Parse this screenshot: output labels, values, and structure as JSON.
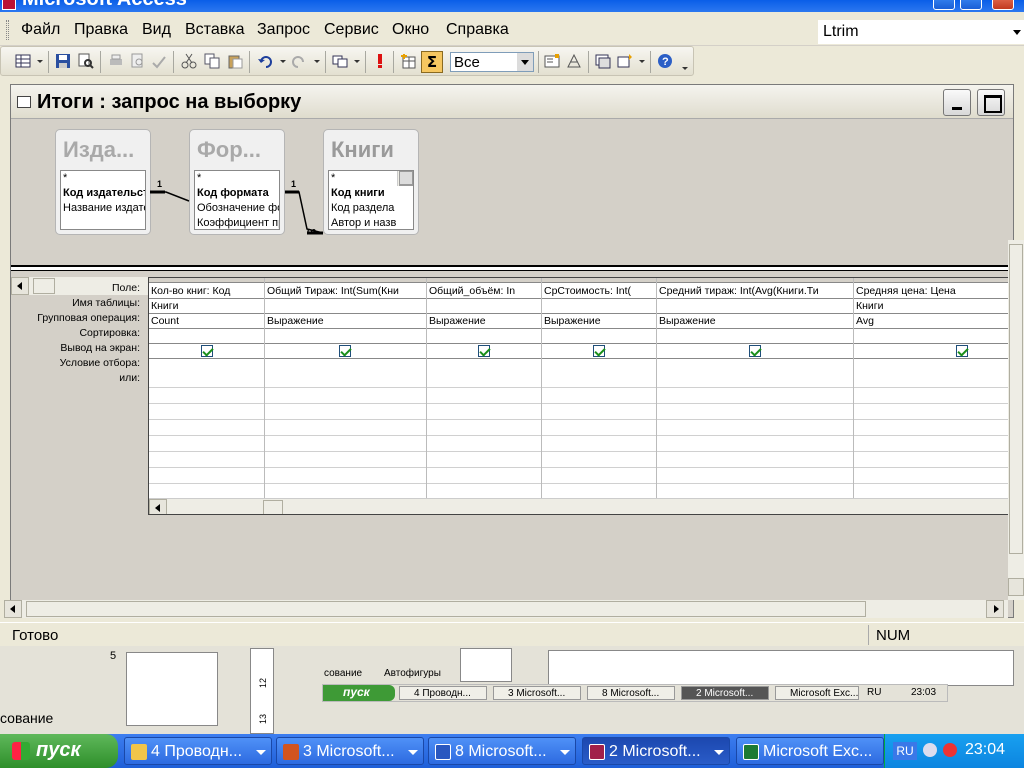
{
  "app": {
    "title": "Microsoft Access"
  },
  "menu": [
    "Файл",
    "Правка",
    "Вид",
    "Вставка",
    "Запрос",
    "Сервис",
    "Окно",
    "Справка"
  ],
  "help_box": {
    "value": "Ltrim"
  },
  "toolbar": {
    "sigma": "Σ",
    "top_values": "Все"
  },
  "query_window": {
    "title": "Итоги : запрос на выборку"
  },
  "tables": [
    {
      "title": "Изда...",
      "fields": [
        "*",
        "Код издательст",
        "Название издате"
      ],
      "pk_index": 1
    },
    {
      "title": "Фор...",
      "fields": [
        "*",
        "Код формата",
        "Обозначение фо",
        "Коэффициент пр"
      ],
      "pk_index": 1
    },
    {
      "title": "Книги",
      "fields": [
        "*",
        "Код книги",
        "Код раздела",
        "Автор и назв"
      ],
      "pk_index": 1
    }
  ],
  "relations": {
    "one_1": "1",
    "one_2": "1",
    "many": "∞"
  },
  "grid": {
    "row_labels": [
      "Поле:",
      "Имя таблицы:",
      "Групповая операция:",
      "Сортировка:",
      "Вывод на экран:",
      "Условие отбора:",
      "или:"
    ],
    "columns": [
      {
        "field": "Кол-во книг: Код",
        "table": "Книги",
        "group": "Count",
        "sort": "",
        "show": true
      },
      {
        "field": "Общий Тираж: Int(Sum(Кни",
        "table": "",
        "group": "Выражение",
        "sort": "",
        "show": true
      },
      {
        "field": "Общий_объём: In",
        "table": "",
        "group": "Выражение",
        "sort": "",
        "show": true
      },
      {
        "field": "СрСтоимость: Int(",
        "table": "",
        "group": "Выражение",
        "sort": "",
        "show": true
      },
      {
        "field": "Средний тираж: Int(Avg(Книги.Ти",
        "table": "",
        "group": "Выражение",
        "sort": "",
        "show": true
      },
      {
        "field": "Средняя цена: Цена",
        "table": "Книги",
        "group": "Avg",
        "sort": "",
        "show": true
      }
    ]
  },
  "status": {
    "text": "Готово",
    "num": "NUM"
  },
  "backdrop": {
    "page_number": "5",
    "ruler_12": "12",
    "ruler_13": "13",
    "drawing_label": "сование",
    "autoshapes": "Автофигуры",
    "left_drawing": "сование"
  },
  "mini_taskbar": {
    "start": "пуск",
    "tasks": [
      "4 Проводн...",
      "3 Microsoft...",
      "8 Microsoft...",
      "2 Microsoft...",
      "Microsoft Exc..."
    ],
    "lang": "RU",
    "clock": "23:03"
  },
  "taskbar": {
    "start": "пуск",
    "tasks": [
      "4 Проводн...",
      "3 Microsoft...",
      "8 Microsoft...",
      "2 Microsoft...",
      "Microsoft Exc..."
    ],
    "lang": "RU",
    "clock": "23:04"
  }
}
